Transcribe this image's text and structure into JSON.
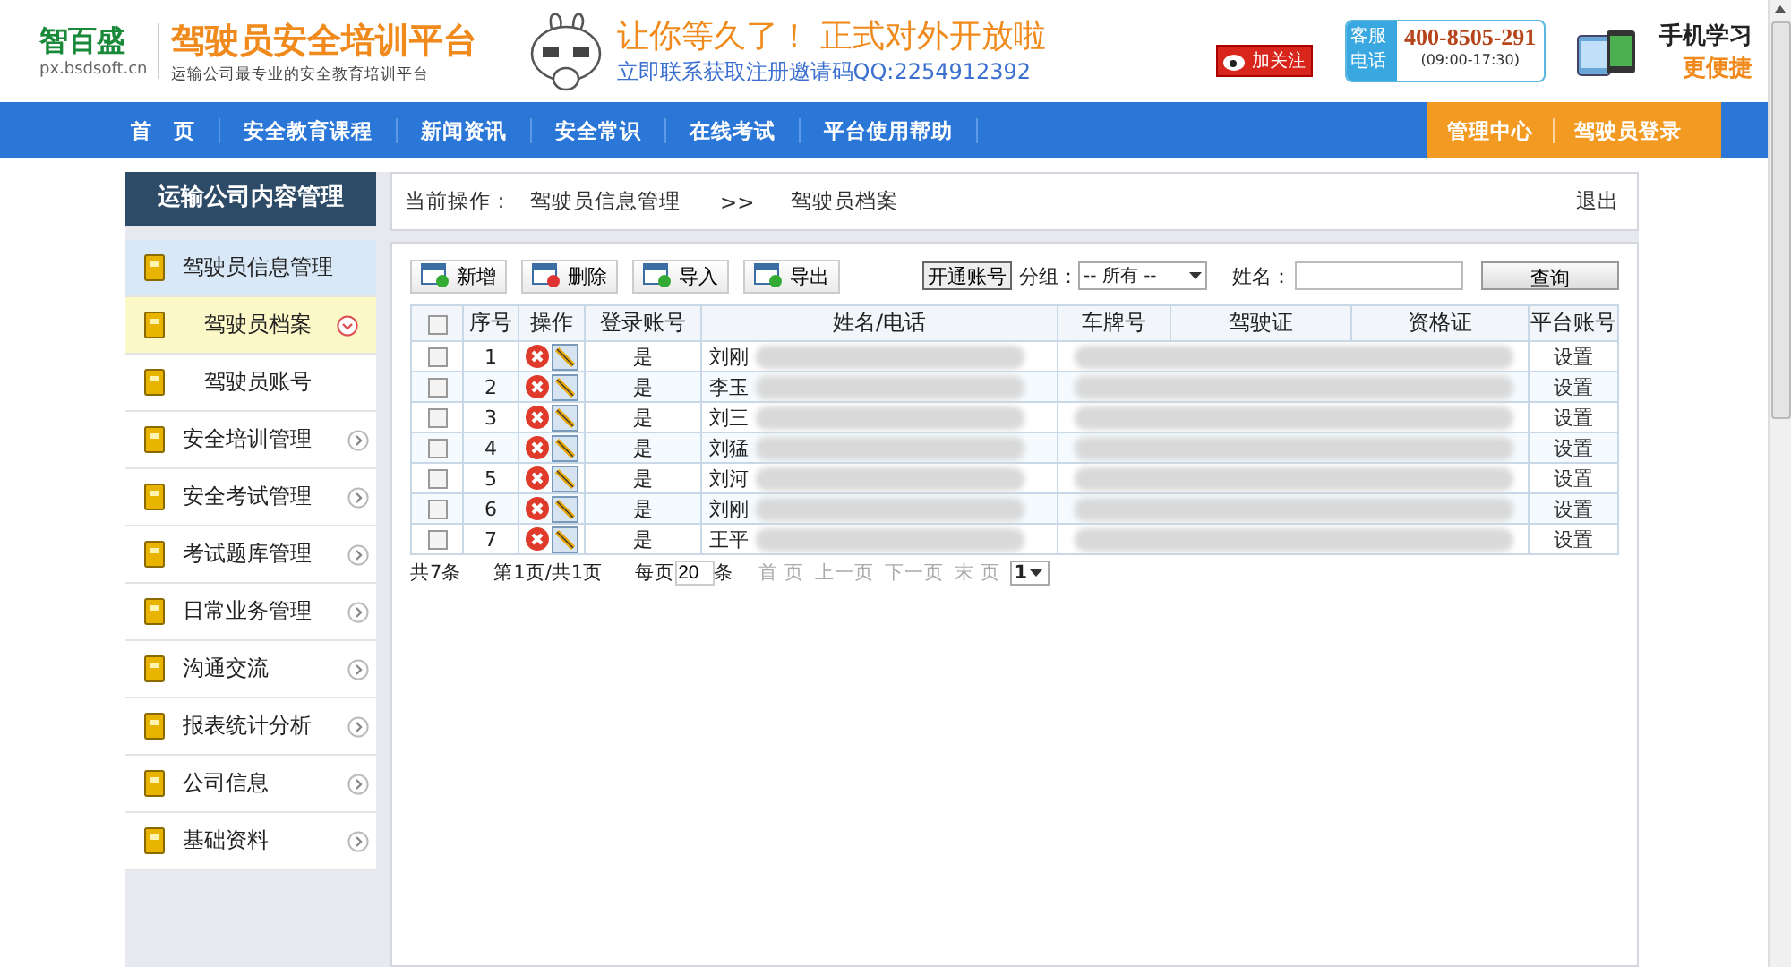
{
  "header": {
    "brand": "智百盛",
    "domain": "px.bsdsoft.cn",
    "title": "驾驶员安全培训平台",
    "subtitle": "运输公司最专业的安全教育培训平台",
    "promo": "让你等久了！ 正式对外开放啦",
    "promo_sub": "立即联系获取注册邀请码QQ:2254912392",
    "weibo": "加关注",
    "hotline_label": [
      "客服",
      "电话"
    ],
    "hotline": "400-8505-291",
    "hours": "(09:00-17:30)",
    "mobile_1": "手机学习",
    "mobile_2": "更便捷"
  },
  "nav": {
    "items": [
      {
        "label": "首　页",
        "selected": false
      },
      {
        "label": "安全教育课程",
        "selected": false
      },
      {
        "label": "新闻资讯",
        "selected": false
      },
      {
        "label": "安全常识",
        "selected": false
      },
      {
        "label": "在线考试",
        "selected": false
      },
      {
        "label": "平台使用帮助",
        "selected": false
      }
    ],
    "right": [
      {
        "label": "管理中心"
      },
      {
        "label": "驾驶员登录"
      }
    ]
  },
  "sidebar": {
    "title": "运输公司内容管理",
    "items": [
      {
        "label": "驾驶员信息管理",
        "expanded": true,
        "children": [
          {
            "label": "驾驶员档案",
            "selected": true
          },
          {
            "label": "驾驶员账号",
            "selected": false
          }
        ]
      },
      {
        "label": "安全培训管理",
        "expanded": false
      },
      {
        "label": "安全考试管理",
        "expanded": false
      },
      {
        "label": "考试题库管理",
        "expanded": false
      },
      {
        "label": "日常业务管理",
        "expanded": false
      },
      {
        "label": "沟通交流",
        "expanded": false
      },
      {
        "label": "报表统计分析",
        "expanded": false
      },
      {
        "label": "公司信息",
        "expanded": false
      },
      {
        "label": "基础资料",
        "expanded": false
      }
    ]
  },
  "breadcrumb": {
    "label": "当前操作：",
    "path": [
      "驾驶员信息管理",
      "驾驶员档案"
    ],
    "separator": ">>",
    "logout": "退出"
  },
  "toolbar": {
    "buttons": [
      {
        "label": "新增",
        "kind": "add"
      },
      {
        "label": "删除",
        "kind": "delete"
      },
      {
        "label": "导入",
        "kind": "add"
      },
      {
        "label": "导出",
        "kind": "add"
      }
    ],
    "open_account": "开通账号",
    "group_label": "分组：",
    "group_value": "-- 所有 --",
    "name_label": "姓名：",
    "query": "查询"
  },
  "table": {
    "select_all_checked": false,
    "columns": [
      "序号",
      "操作",
      "登录账号",
      "姓名/电话",
      "车牌号",
      "驾驶证",
      "资格证",
      "平台账号"
    ],
    "rows": [
      {
        "checked": false,
        "index": "1",
        "login": "是",
        "name": "刘刚",
        "platform": "设置"
      },
      {
        "checked": false,
        "index": "2",
        "login": "是",
        "name": "李玉",
        "platform": "设置"
      },
      {
        "checked": false,
        "index": "3",
        "login": "是",
        "name": "刘三",
        "platform": "设置"
      },
      {
        "checked": false,
        "index": "4",
        "login": "是",
        "name": "刘猛",
        "platform": "设置"
      },
      {
        "checked": false,
        "index": "5",
        "login": "是",
        "name": "刘河",
        "platform": "设置"
      },
      {
        "checked": false,
        "index": "6",
        "login": "是",
        "name": "刘刚",
        "platform": "设置"
      },
      {
        "checked": false,
        "index": "7",
        "login": "是",
        "name": "王平",
        "platform": "设置"
      }
    ]
  },
  "pager": {
    "total": "共7条",
    "page": "第1页/共1页",
    "per_page_pre": "每页",
    "per_page": "20",
    "per_page_post": "条",
    "links": [
      "首 页",
      "上一页",
      "下一页",
      "末 页"
    ],
    "page_select": "1"
  }
}
